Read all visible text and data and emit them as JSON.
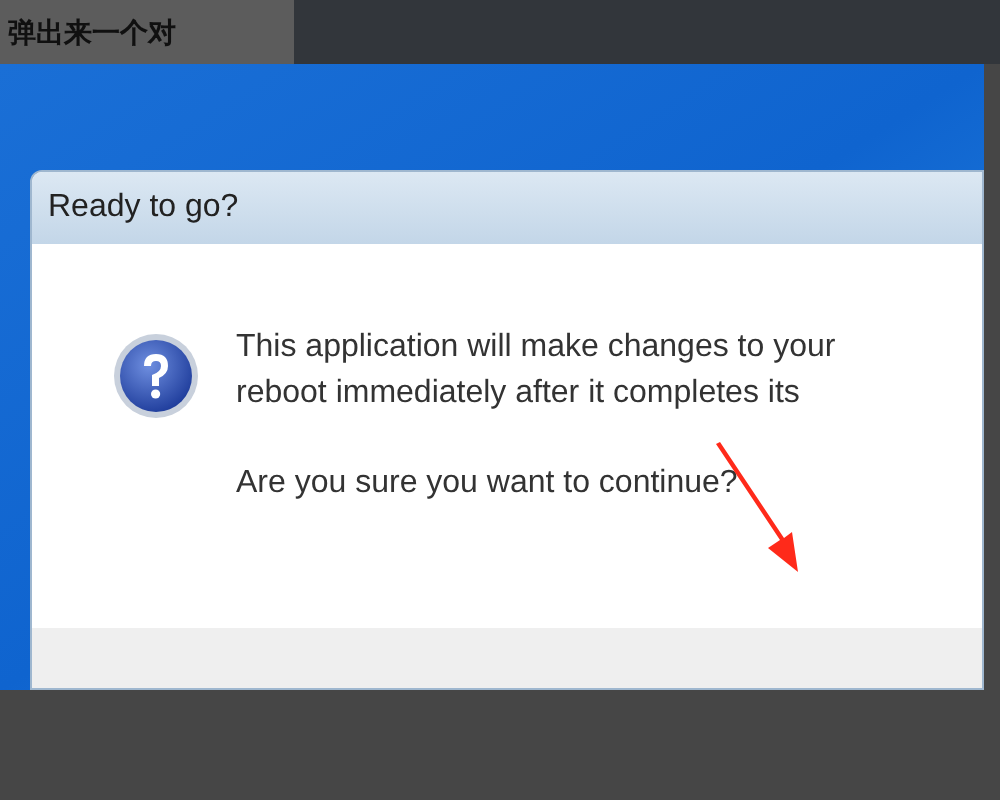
{
  "caption": "弹出来一个对",
  "dialog": {
    "title": "Ready to go?",
    "message_lines": [
      "This application will make changes to your",
      "reboot immediately after it completes its"
    ],
    "question": "Are you sure you want to continue?"
  }
}
